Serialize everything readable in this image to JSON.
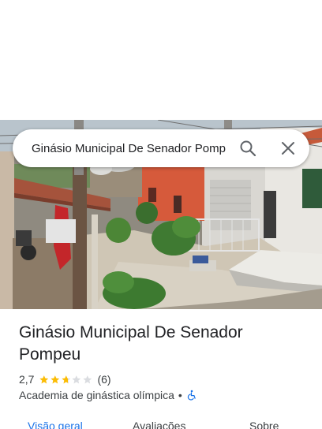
{
  "search": {
    "query": "Ginásio Municipal De Senador Pomp",
    "search_icon": "search-icon",
    "close_icon": "close-icon"
  },
  "place": {
    "title": "Ginásio Municipal De Senador Pompeu",
    "rating": "2,7",
    "rating_value": 2.7,
    "stars_max": 5,
    "review_count": "(6)",
    "category": "Academia de ginástica olímpica",
    "separator": "•",
    "accessibility_icon": "wheelchair-icon"
  },
  "tabs": [
    {
      "label": "Visão geral",
      "active": true
    },
    {
      "label": "Avaliações",
      "active": false
    },
    {
      "label": "Sobre",
      "active": false
    }
  ],
  "colors": {
    "accent": "#1a73e8",
    "star": "#fbbc04",
    "star_empty": "#dadce0"
  }
}
